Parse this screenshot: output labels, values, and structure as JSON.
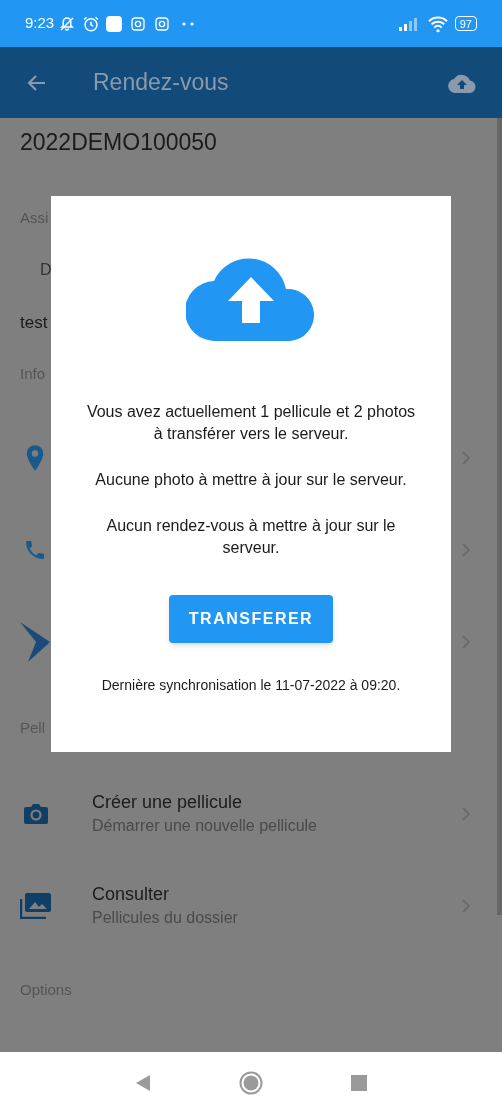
{
  "status_bar": {
    "time": "9:23",
    "battery": "97"
  },
  "app_bar": {
    "title": "Rendez-vous"
  },
  "record_id": "2022DEMO100050",
  "assignment": {
    "heading": "Assi",
    "field_label": "D",
    "value": "test"
  },
  "info": {
    "heading": "Info",
    "rows": [
      {
        "kind": "location"
      },
      {
        "kind": "phone"
      },
      {
        "kind": "logo"
      }
    ]
  },
  "films": {
    "heading": "Pell",
    "rows": [
      {
        "kind": "camera",
        "title": "Créer une pellicule",
        "subtitle": "Démarrer une nouvelle pellicule"
      },
      {
        "kind": "gallery",
        "title": "Consulter",
        "subtitle": "Pellicules du dossier"
      }
    ]
  },
  "options": {
    "heading": "Options"
  },
  "dialog": {
    "messages": [
      "Vous avez actuellement 1 pellicule et 2 photos à transférer vers le serveur.",
      "Aucune photo à mettre à jour sur le serveur.",
      "Aucun rendez-vous à mettre à jour sur le serveur."
    ],
    "button": "TRANSFERER",
    "last_sync": "Dernière synchronisation le 11-07-2022 à 09:20."
  }
}
